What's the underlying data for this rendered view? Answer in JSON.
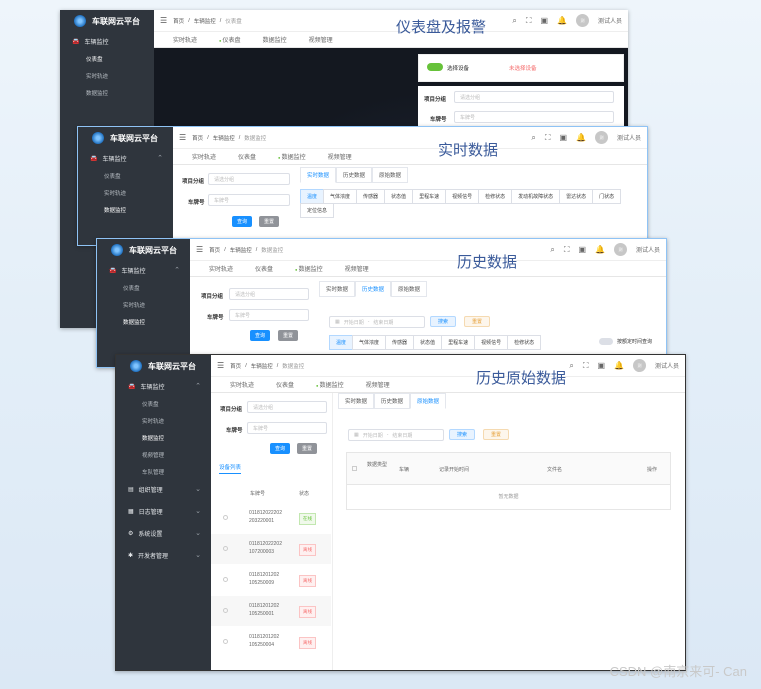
{
  "app_title": "车联网云平台",
  "user": {
    "name": "测试人员",
    "avatar": "测"
  },
  "breadcrumb_root": "首页",
  "breadcrumb_parent": "车辆监控",
  "sidebar": {
    "group": "车辆监控",
    "items": [
      "仪表盘",
      "实时轨迹",
      "数据监控",
      "视频管理",
      "车队管理"
    ],
    "groups": [
      "组织管理",
      "日志管理",
      "系统设置",
      "开发者管理"
    ]
  },
  "tabs": [
    "实时轨迹",
    "仪表盘",
    "数据监控",
    "视频管理"
  ],
  "screens": [
    {
      "title": "仪表盘及报警",
      "bc_current": "仪表盘",
      "toggle_label": "选择设备",
      "warning": "未选择设备"
    },
    {
      "title": "实时数据",
      "bc_current": "数据监控"
    },
    {
      "title": "历史数据",
      "bc_current": "数据监控"
    },
    {
      "title": "历史原始数据",
      "bc_current": "数据监控"
    }
  ],
  "form": {
    "project_label": "项目分组",
    "project_ph": "请选分组",
    "plate_label": "车牌号",
    "plate_ph": "车牌号",
    "query": "查询",
    "reset": "重置",
    "device_list": "设备列表"
  },
  "data_tabs": [
    "实时数据",
    "历史数据",
    "原始数据"
  ],
  "realtime_chips": [
    "温度",
    "气体浓度",
    "传感器",
    "状态值",
    "里程车速",
    "视频信号",
    "检修状态",
    "发动机故障状态",
    "雷达状态",
    "门状态",
    "定位信息"
  ],
  "history_chips": [
    "温度",
    "气体浓度",
    "传感器",
    "状态值",
    "里程车速",
    "视频信号",
    "检修状态"
  ],
  "history_toggle": "按额定时间查询",
  "date": {
    "start": "开始日期",
    "sep": "-",
    "end": "结束日期",
    "search": "搜索",
    "reset": "重置"
  },
  "raw_table": {
    "headers": [
      "数据类型",
      "车辆",
      "记录开始时间",
      "文件名",
      "操作"
    ],
    "empty": "暂无数据"
  },
  "device_table": {
    "h_plate": "车牌号",
    "h_status": "状态"
  },
  "devices": [
    {
      "id1": "011812022202",
      "id2": "203220001",
      "status": "在线"
    },
    {
      "id1": "011812022202",
      "id2": "107200003",
      "status": "离线"
    },
    {
      "id1": "01181201202",
      "id2": "105250009",
      "status": "离线"
    },
    {
      "id1": "01181201202",
      "id2": "105250001",
      "status": "离线"
    },
    {
      "id1": "01181201202",
      "id2": "105250004",
      "status": "离线"
    }
  ],
  "watermark": "CSDN @南京来可- Can"
}
